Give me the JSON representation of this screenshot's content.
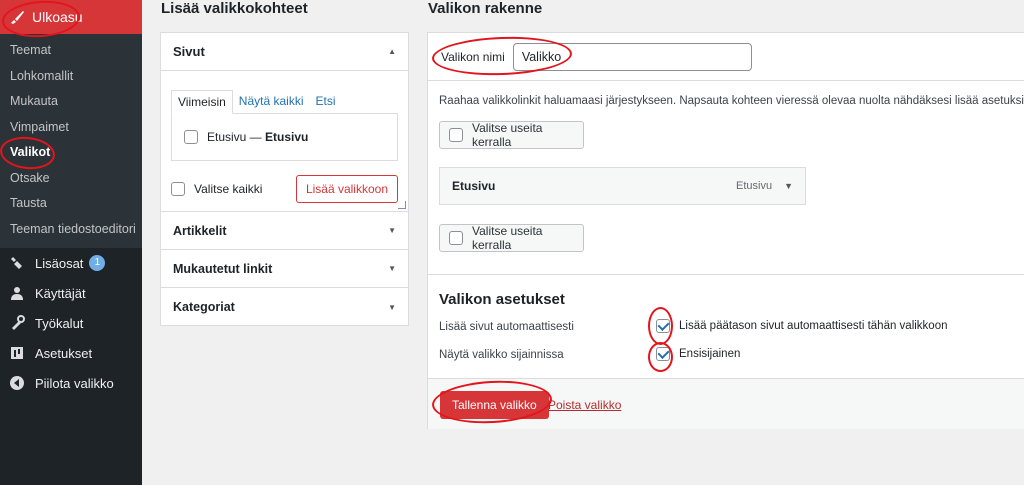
{
  "sidebar": {
    "active_menu": "Ulkoasu",
    "submenu": [
      "Teemat",
      "Lohkomallit",
      "Mukauta",
      "Vimpaimet",
      "Valikot",
      "Otsake",
      "Tausta",
      "Teeman tiedostoeditori"
    ],
    "current_submenu": "Valikot",
    "items": [
      {
        "label": "Lisäosat",
        "icon": "plugin-icon",
        "badge": "1"
      },
      {
        "label": "Käyttäjät",
        "icon": "users-icon"
      },
      {
        "label": "Työkalut",
        "icon": "tools-icon"
      },
      {
        "label": "Asetukset",
        "icon": "settings-icon"
      },
      {
        "label": "Piilota valikko",
        "icon": "collapse-icon"
      }
    ]
  },
  "add_items": {
    "heading": "Lisää valikkokohteet",
    "pages": {
      "title": "Sivut",
      "tabs": [
        "Viimeisin",
        "Näytä kaikki",
        "Etsi"
      ],
      "item_label": "Etusivu — ",
      "item_bold": "Etusivu",
      "select_all": "Valitse kaikki",
      "add_button": "Lisää valikkoon"
    },
    "sections": [
      "Artikkelit",
      "Mukautetut linkit",
      "Kategoriat"
    ]
  },
  "structure": {
    "heading": "Valikon rakenne",
    "name_label": "Valikon nimi",
    "name_value": "Valikko",
    "help": "Raahaa valikkolinkit haluamaasi järjestykseen. Napsauta kohteen vieressä olevaa nuolta nähdäksesi lisää asetuksia.",
    "bulk_select": "Valitse useita kerralla",
    "menu_item": {
      "title": "Etusivu",
      "type": "Etusivu"
    },
    "settings_title": "Valikon asetukset",
    "auto_add_label": "Lisää sivut automaattisesti",
    "auto_add_value": "Lisää päätason sivut automaattisesti tähän valikkoon",
    "location_label": "Näytä valikko sijainnissa",
    "location_value": "Ensisijainen",
    "save_button": "Tallenna valikko",
    "delete_link": "Poista valikko"
  },
  "colors": {
    "accent": "#d63638",
    "sidebar": "#1d2327",
    "annotation": "#e3141c"
  }
}
